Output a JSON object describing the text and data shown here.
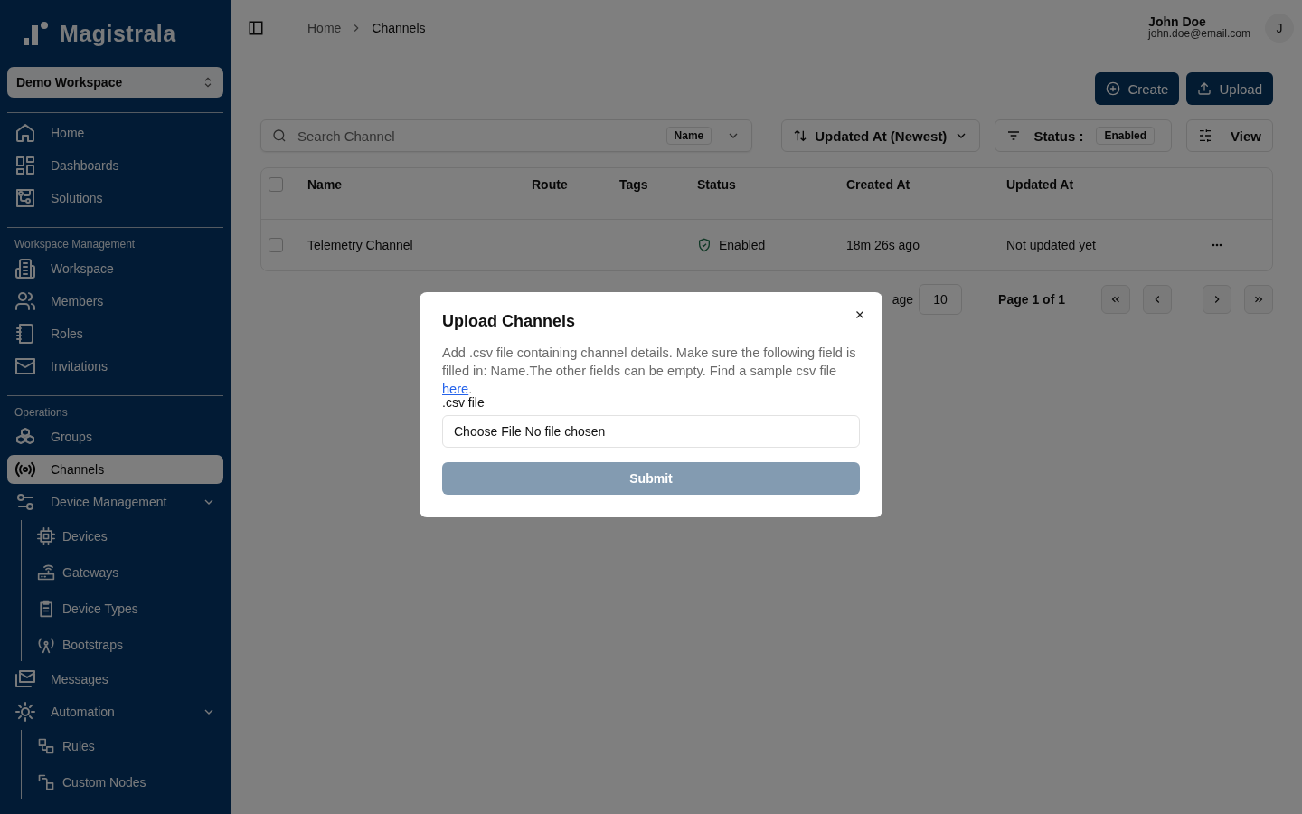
{
  "sidebar": {
    "logo": "Magistrala",
    "workspace": "Demo Workspace",
    "sections": [
      {
        "items": [
          {
            "label": "Home",
            "selected": false
          },
          {
            "label": "Dashboards",
            "selected": false
          },
          {
            "label": "Solutions",
            "selected": false
          }
        ]
      },
      {
        "title": "Workspace Management",
        "items": [
          {
            "label": "Workspace",
            "selected": false
          },
          {
            "label": "Members",
            "selected": false
          },
          {
            "label": "Roles",
            "selected": false
          },
          {
            "label": "Invitations",
            "selected": false
          }
        ]
      },
      {
        "title": "Operations",
        "items": [
          {
            "label": "Groups",
            "selected": false
          },
          {
            "label": "Channels",
            "selected": true
          },
          {
            "label": "Device Management",
            "selected": false,
            "expanded": true,
            "children": [
              {
                "label": "Devices",
                "selected": false
              },
              {
                "label": "Gateways",
                "selected": false
              },
              {
                "label": "Device Types",
                "selected": false
              },
              {
                "label": "Bootstraps",
                "selected": false
              }
            ]
          },
          {
            "label": "Messages",
            "selected": false
          },
          {
            "label": "Automation",
            "selected": false,
            "expanded": true,
            "children": [
              {
                "label": "Rules",
                "selected": false
              },
              {
                "label": "Custom Nodes",
                "selected": false
              }
            ]
          }
        ]
      }
    ]
  },
  "header": {
    "breadcrumb": [
      "Home",
      "Channels"
    ],
    "user": {
      "name": "John Doe",
      "email": "john.doe@email.com",
      "initial": "J"
    }
  },
  "actions": [
    "Create",
    "Upload"
  ],
  "toolbar": {
    "search": {
      "placeholder": "Search Channel",
      "field": "Name"
    },
    "sort": "Updated At (Newest)",
    "status_label": "Status :",
    "status_value": "Enabled",
    "view": "View"
  },
  "table": {
    "columns": [
      "Name",
      "Route",
      "Tags",
      "Status",
      "Created At",
      "Updated At"
    ],
    "all_checked": false,
    "rows": [
      {
        "checked": false,
        "name": "Telemetry Channel",
        "status": "Enabled",
        "created": "18m 26s ago",
        "updated": "Not updated yet"
      }
    ]
  },
  "pagination": {
    "rows_label": "age",
    "rows_per_page": "10",
    "page": "Page 1 of 1"
  },
  "modal": {
    "title": "Upload Channels",
    "description": "Add .csv file containing channel details. Make sure the following field is filled in: Name.The other fields can be empty. Find a sample csv file ",
    "link": "here",
    "description_end": ".",
    "file_label": ".csv file",
    "file_value": "Choose File No file chosen",
    "submit": "Submit",
    "submit_disabled": true
  }
}
